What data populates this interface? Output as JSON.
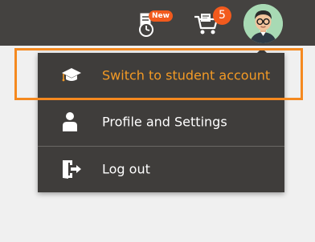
{
  "header": {
    "timesheet_badge": "New",
    "cart_count": "5",
    "icons": {
      "timesheet": "timesheet-clock-icon",
      "cart": "shopping-cart-icon",
      "avatar": "user-avatar"
    }
  },
  "menu": {
    "items": [
      {
        "label": "Switch to student account",
        "icon": "graduation-cap-icon",
        "active": true
      },
      {
        "label": "Profile and Settings",
        "icon": "user-icon"
      },
      {
        "label": "Log out",
        "icon": "logout-door-icon"
      }
    ]
  },
  "colors": {
    "header_bg": "#444240",
    "menu_bg": "#3f3d3b",
    "accent": "#f39a25",
    "badge": "#f25a1d",
    "highlight_outline": "#f5891f"
  }
}
